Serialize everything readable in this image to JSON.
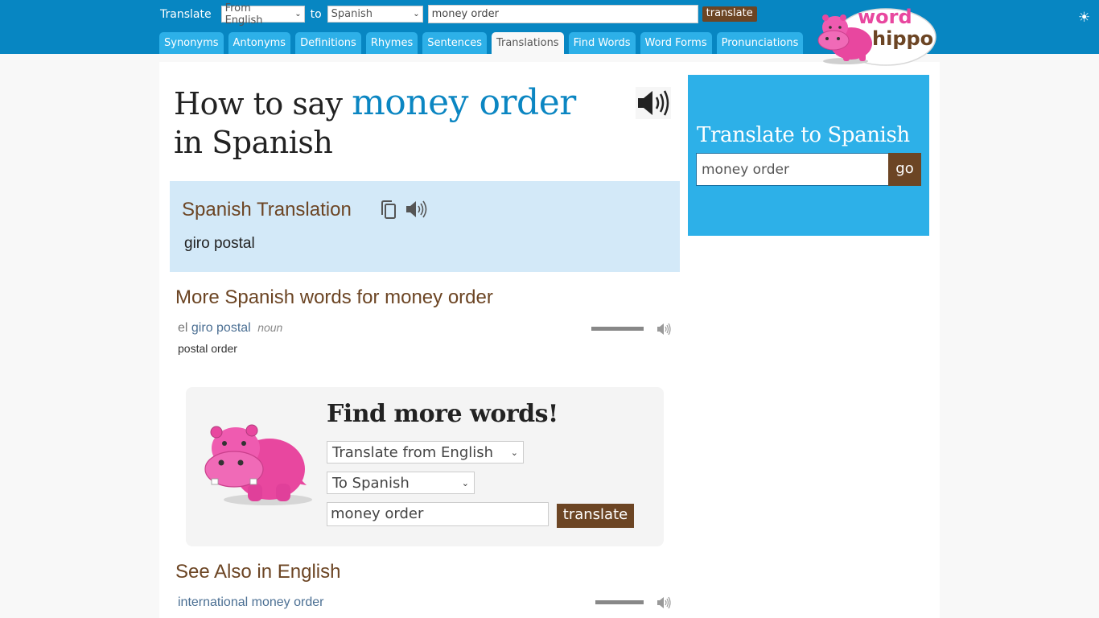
{
  "header": {
    "translate_label": "Translate",
    "from_select": "From English",
    "to_label": "to",
    "to_select": "Spanish",
    "query": "money order",
    "translate_button": "translate",
    "tabs": [
      {
        "label": "Synonyms",
        "active": false
      },
      {
        "label": "Antonyms",
        "active": false
      },
      {
        "label": "Definitions",
        "active": false
      },
      {
        "label": "Rhymes",
        "active": false
      },
      {
        "label": "Sentences",
        "active": false
      },
      {
        "label": "Translations",
        "active": true
      },
      {
        "label": "Find Words",
        "active": false
      },
      {
        "label": "Word Forms",
        "active": false
      },
      {
        "label": "Pronunciations",
        "active": false
      }
    ],
    "logo_top": "word",
    "logo_bottom": "hippo",
    "theme_icon": "sun-icon"
  },
  "page": {
    "title_prefix": "How to say",
    "title_keyword": "money order",
    "title_suffix": "in Spanish"
  },
  "translation": {
    "heading": "Spanish Translation",
    "text": "giro postal"
  },
  "more_words": {
    "heading": "More Spanish words for money order",
    "items": [
      {
        "article": "el",
        "word": "giro postal",
        "pos": "noun",
        "definition": "postal order",
        "frequency": 1.0
      }
    ]
  },
  "find_more": {
    "title": "Find more words!",
    "from_select": "Translate from English",
    "to_select": "To Spanish",
    "input_value": "money order",
    "button": "translate"
  },
  "see_also": {
    "heading": "See Also in English",
    "items": [
      {
        "word": "international money order",
        "frequency": 1.0
      }
    ]
  },
  "sidebar": {
    "title": "Translate to Spanish",
    "input_value": "money order",
    "go_button": "go"
  },
  "colors": {
    "header_bg": "#0786c2",
    "tab_bg": "#2db0e8",
    "accent_brown": "#6c4524",
    "keyword_blue": "#0b86c2",
    "translation_bg": "#d3e9f8",
    "hippo_pink": "#e8479f"
  }
}
